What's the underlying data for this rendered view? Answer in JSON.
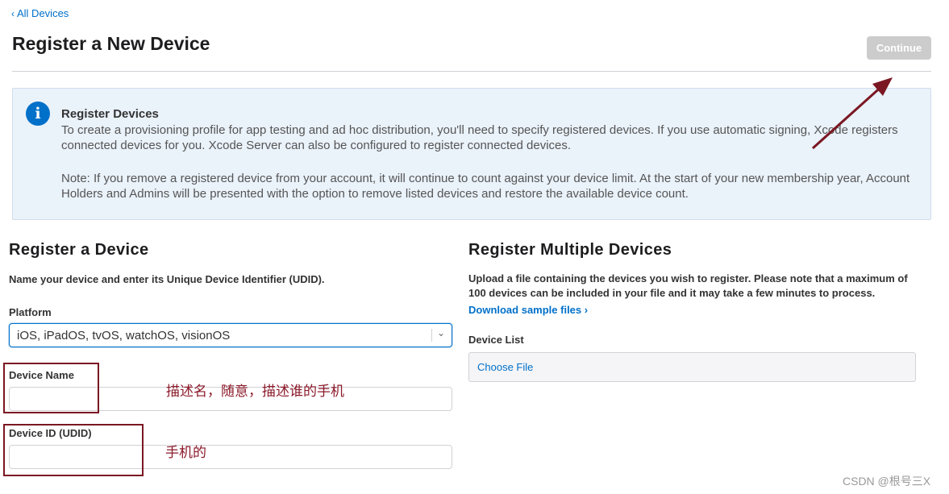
{
  "nav": {
    "back_chevron": "‹",
    "back_label": "All Devices"
  },
  "header": {
    "title": "Register a New Device",
    "continue_label": "Continue"
  },
  "info": {
    "icon": "info-icon",
    "icon_glyph": "i",
    "title": "Register Devices",
    "paragraph1": "To create a provisioning profile for app testing and ad hoc distribution, you'll need to specify registered devices. If you use automatic signing, Xcode registers connected devices for you. Xcode Server can also be configured to register connected devices.",
    "paragraph2": "Note: If you remove a registered device from your account, it will continue to count against your device limit. At the start of your new membership year, Account Holders and Admins will be presented with the option to remove listed devices and restore the available device count."
  },
  "single": {
    "title": "Register a Device",
    "description": "Name your device and enter its Unique Device Identifier (UDID).",
    "platform_label": "Platform",
    "platform_value": "iOS, iPadOS, tvOS, watchOS, visionOS",
    "device_name_label": "Device Name",
    "device_name_value": "",
    "device_id_label": "Device ID (UDID)",
    "device_id_value": ""
  },
  "multiple": {
    "title": "Register Multiple Devices",
    "description": "Upload a file containing the devices you wish to register. Please note that a maximum of 100 devices can be included in your file and it may take a few minutes to process.",
    "download_label": "Download sample files ›",
    "device_list_label": "Device List",
    "choose_file_label": "Choose File"
  },
  "annotations": {
    "device_name_note": "描述名，随意，描述谁的手机",
    "device_id_note": "手机的",
    "color": "#7a1722"
  },
  "watermark": "CSDN @根号三X",
  "colors": {
    "accent": "#0070c9",
    "info_bg": "#eaf2fa",
    "disabled_button": "#cccccc"
  }
}
